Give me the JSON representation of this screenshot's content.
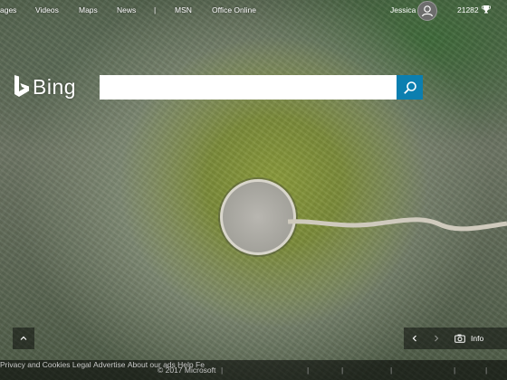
{
  "nav": {
    "links": [
      "ages",
      "Videos",
      "Maps",
      "News",
      "|",
      "MSN",
      "Office Online"
    ],
    "user_name": "Jessica",
    "reward_count": "21282"
  },
  "logo": {
    "text": "Bing"
  },
  "search": {
    "value": "",
    "placeholder": ""
  },
  "colors": {
    "search_button": "#0c7fb0",
    "footer_bg": "#000000"
  },
  "icons": {
    "search": "search-icon",
    "avatar": "user-avatar-icon",
    "trophy": "trophy-icon",
    "up": "chevron-up-icon",
    "prev": "chevron-left-icon",
    "next": "chevron-right-icon",
    "camera": "camera-icon"
  },
  "controls": {
    "info_label": "Info"
  },
  "footer": {
    "copyright": "© 2017 Microsoft",
    "links": [
      "Privacy and Cookies",
      "Legal",
      "Advertise",
      "About our ads",
      "Help",
      "Fe"
    ]
  }
}
